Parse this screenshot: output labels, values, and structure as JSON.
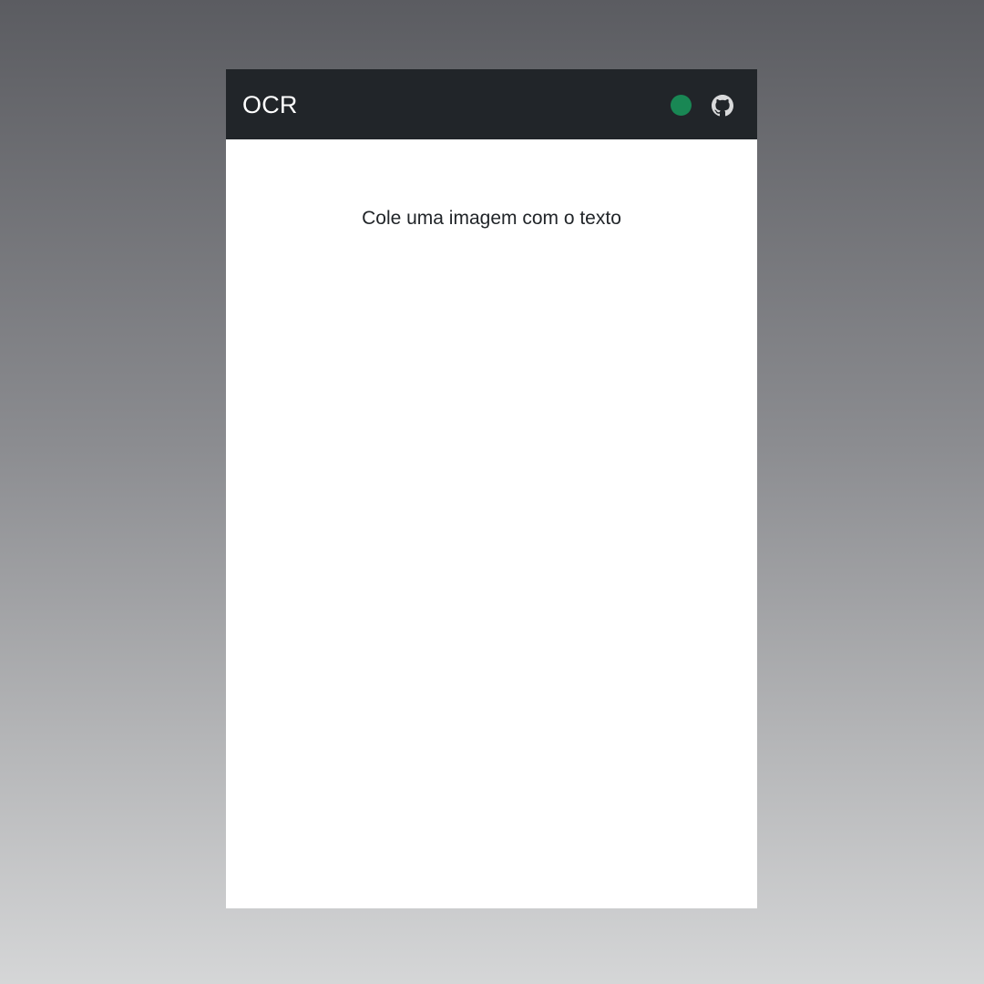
{
  "navbar": {
    "brand": "OCR",
    "status_color": "#198754",
    "status_icon": "status-indicator-dot",
    "github_icon": "github-icon",
    "background_color": "#212529"
  },
  "main": {
    "prompt_text": "Cole uma imagem com o texto"
  }
}
